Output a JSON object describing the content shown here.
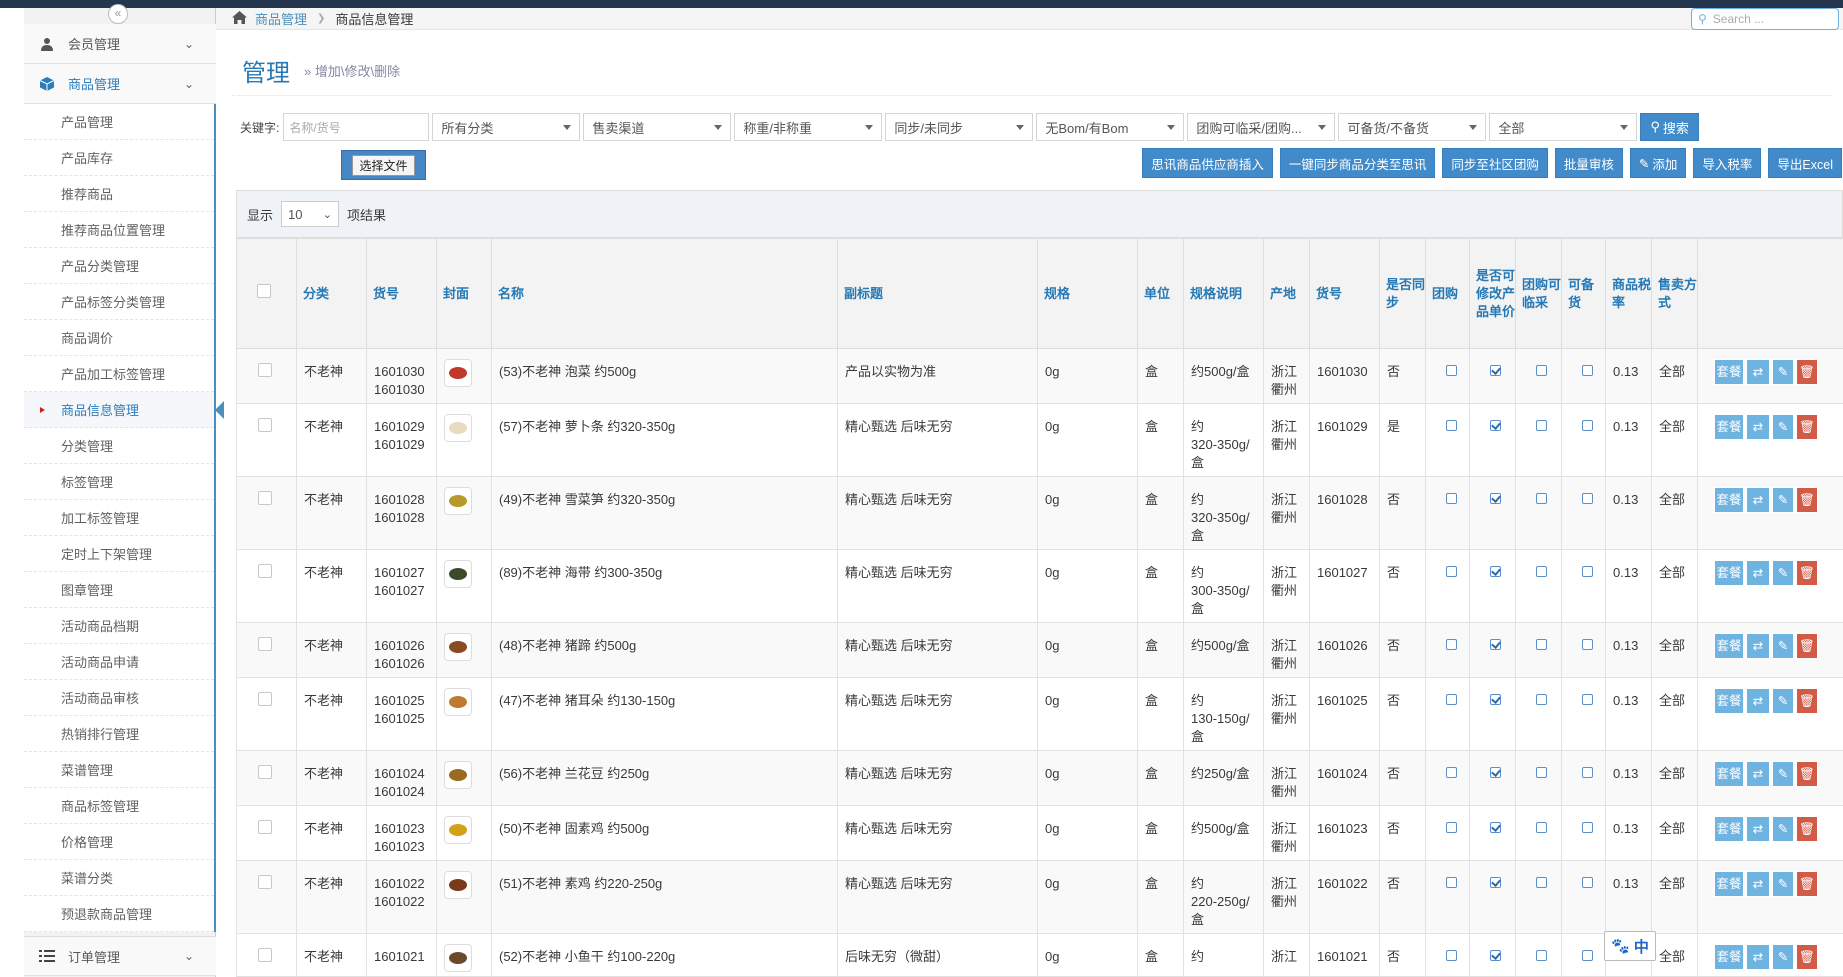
{
  "sidebar": {
    "collapse_label": "«",
    "top_menus": [
      {
        "label": "会员管理"
      },
      {
        "label": "商品管理"
      },
      {
        "label": "订单管理"
      }
    ],
    "items": [
      {
        "label": "产品管理"
      },
      {
        "label": "产品库存"
      },
      {
        "label": "推荐商品"
      },
      {
        "label": "推荐商品位置管理"
      },
      {
        "label": "产品分类管理"
      },
      {
        "label": "产品标签分类管理"
      },
      {
        "label": "商品调价"
      },
      {
        "label": "产品加工标签管理"
      },
      {
        "label": "商品信息管理"
      },
      {
        "label": "分类管理"
      },
      {
        "label": "标签管理"
      },
      {
        "label": "加工标签管理"
      },
      {
        "label": "定时上下架管理"
      },
      {
        "label": "图章管理"
      },
      {
        "label": "活动商品档期"
      },
      {
        "label": "活动商品申请"
      },
      {
        "label": "活动商品审核"
      },
      {
        "label": "热销排行管理"
      },
      {
        "label": "菜谱管理"
      },
      {
        "label": "商品标签管理"
      },
      {
        "label": "价格管理"
      },
      {
        "label": "菜谱分类"
      },
      {
        "label": "预退款商品管理"
      }
    ]
  },
  "breadcrumb": {
    "root": "商品管理",
    "current": "商品信息管理"
  },
  "search": {
    "placeholder": "Search ..."
  },
  "header": {
    "title": "管理",
    "subtitle": "» 增加\\修改\\删除"
  },
  "filters": {
    "keyword_label": "关键字:",
    "keyword_placeholder": "名称/货号",
    "selects": [
      "所有分类",
      "售卖渠道",
      "称重/非称重",
      "同步/未同步",
      "无Bom/有Bom",
      "团购可临采/团购...",
      "可备货/不备货",
      "全部"
    ],
    "search_button": "搜索"
  },
  "file_button": "选择文件",
  "toolbar": [
    "思讯商品供应商插入",
    "一键同步商品分类至思讯",
    "同步至社区团购",
    "批量审核",
    "添加",
    "导入税率",
    "导出Excel"
  ],
  "page_length": {
    "prefix": "显示",
    "value": "10",
    "suffix": "项结果"
  },
  "table": {
    "headers": [
      "分类",
      "货号",
      "封面",
      "名称",
      "副标题",
      "规格",
      "单位",
      "规格说明",
      "产地",
      "货号",
      "是否同步",
      "团购",
      "是否可修改产品单价",
      "团购可临采",
      "可备货",
      "商品税率",
      "售卖方式"
    ],
    "rows": [
      {
        "cat": "不老神",
        "sku": "1601030\n1601030",
        "name": "(53)不老神 泡菜 约500g",
        "sub": "产品以实物为准",
        "spec": "0g",
        "unit": "盒",
        "desc": "约500g/盒",
        "origin": "浙江\n衢州",
        "sku2": "1601030",
        "sync": "否",
        "group": false,
        "editp": true,
        "temp": false,
        "stock": false,
        "tax": "0.13",
        "sale": "全部",
        "color": "#c0392b"
      },
      {
        "cat": "不老神",
        "sku": "1601029\n1601029",
        "name": "(57)不老神 萝卜条 约320-350g",
        "sub": "精心甄选 后味无穷",
        "spec": "0g",
        "unit": "盒",
        "desc": "约\n320-350g/\n盒",
        "origin": "浙江\n衢州",
        "sku2": "1601029",
        "sync": "是",
        "group": false,
        "editp": true,
        "temp": false,
        "stock": false,
        "tax": "0.13",
        "sale": "全部",
        "color": "#e8dcc0"
      },
      {
        "cat": "不老神",
        "sku": "1601028\n1601028",
        "name": "(49)不老神 雪菜笋 约320-350g",
        "sub": "精心甄选 后味无穷",
        "spec": "0g",
        "unit": "盒",
        "desc": "约\n320-350g/\n盒",
        "origin": "浙江\n衢州",
        "sku2": "1601028",
        "sync": "否",
        "group": false,
        "editp": true,
        "temp": false,
        "stock": false,
        "tax": "0.13",
        "sale": "全部",
        "color": "#b89a2a"
      },
      {
        "cat": "不老神",
        "sku": "1601027\n1601027",
        "name": "(89)不老神 海带 约300-350g",
        "sub": "精心甄选 后味无穷",
        "spec": "0g",
        "unit": "盒",
        "desc": "约\n300-350g/\n盒",
        "origin": "浙江\n衢州",
        "sku2": "1601027",
        "sync": "否",
        "group": false,
        "editp": true,
        "temp": false,
        "stock": false,
        "tax": "0.13",
        "sale": "全部",
        "color": "#3d4a2a"
      },
      {
        "cat": "不老神",
        "sku": "1601026\n1601026",
        "name": "(48)不老神 猪蹄 约500g",
        "sub": "精心甄选 后味无穷",
        "spec": "0g",
        "unit": "盒",
        "desc": "约500g/盒",
        "origin": "浙江\n衢州",
        "sku2": "1601026",
        "sync": "否",
        "group": false,
        "editp": true,
        "temp": false,
        "stock": false,
        "tax": "0.13",
        "sale": "全部",
        "color": "#8a4a22"
      },
      {
        "cat": "不老神",
        "sku": "1601025\n1601025",
        "name": "(47)不老神 猪耳朵 约130-150g",
        "sub": "精心甄选 后味无穷",
        "spec": "0g",
        "unit": "盒",
        "desc": "约\n130-150g/\n盒",
        "origin": "浙江\n衢州",
        "sku2": "1601025",
        "sync": "否",
        "group": false,
        "editp": true,
        "temp": false,
        "stock": false,
        "tax": "0.13",
        "sale": "全部",
        "color": "#c07a30"
      },
      {
        "cat": "不老神",
        "sku": "1601024\n1601024",
        "name": "(56)不老神 兰花豆 约250g",
        "sub": "精心甄选 后味无穷",
        "spec": "0g",
        "unit": "盒",
        "desc": "约250g/盒",
        "origin": "浙江\n衢州",
        "sku2": "1601024",
        "sync": "否",
        "group": false,
        "editp": true,
        "temp": false,
        "stock": false,
        "tax": "0.13",
        "sale": "全部",
        "color": "#9a6a20"
      },
      {
        "cat": "不老神",
        "sku": "1601023\n1601023",
        "name": "(50)不老神 固素鸡 约500g",
        "sub": "精心甄选 后味无穷",
        "spec": "0g",
        "unit": "盒",
        "desc": "约500g/盒",
        "origin": "浙江\n衢州",
        "sku2": "1601023",
        "sync": "否",
        "group": false,
        "editp": true,
        "temp": false,
        "stock": false,
        "tax": "0.13",
        "sale": "全部",
        "color": "#d4a017"
      },
      {
        "cat": "不老神",
        "sku": "1601022\n1601022",
        "name": "(51)不老神 素鸡 约220-250g",
        "sub": "精心甄选 后味无穷",
        "spec": "0g",
        "unit": "盒",
        "desc": "约\n220-250g/\n盒",
        "origin": "浙江\n衢州",
        "sku2": "1601022",
        "sync": "否",
        "group": false,
        "editp": true,
        "temp": false,
        "stock": false,
        "tax": "0.13",
        "sale": "全部",
        "color": "#7a3a1a"
      },
      {
        "cat": "不老神",
        "sku": "1601021",
        "name": "(52)不老神 小鱼干 约100-220g",
        "sub": "后味无穷（微甜）",
        "spec": "0g",
        "unit": "盒",
        "desc": "约",
        "origin": "浙江",
        "sku2": "1601021",
        "sync": "否",
        "group": false,
        "editp": true,
        "temp": false,
        "stock": false,
        "tax": "0.13",
        "sale": "全部",
        "color": "#6a4a2a"
      }
    ],
    "action_labels": {
      "package": "套餐"
    }
  },
  "ime": {
    "label": "中"
  }
}
